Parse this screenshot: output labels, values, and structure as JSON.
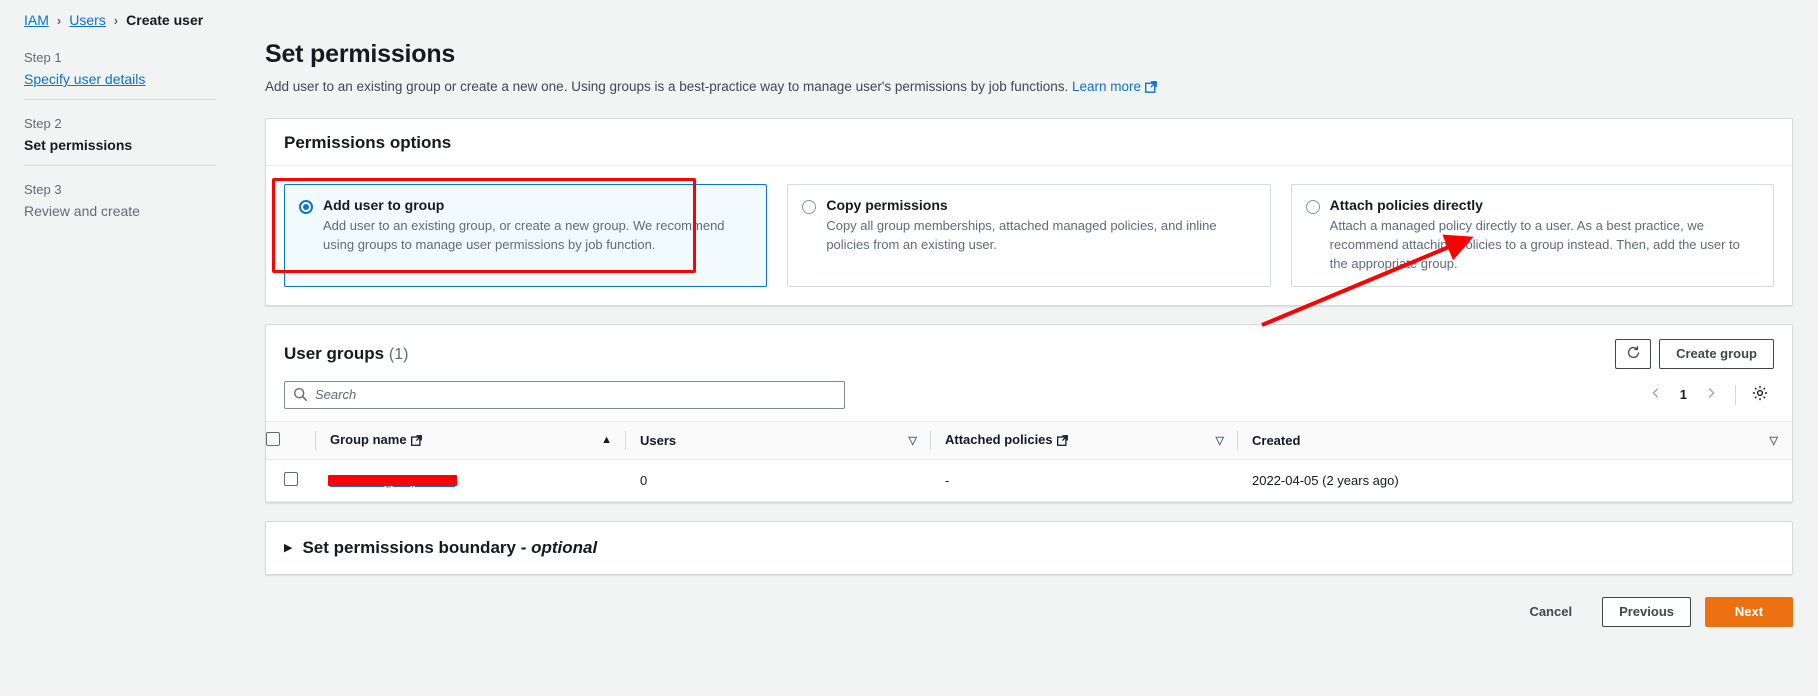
{
  "breadcrumb": {
    "items": [
      {
        "label": "IAM",
        "link": true
      },
      {
        "label": "Users",
        "link": true
      },
      {
        "label": "Create user",
        "link": false
      }
    ],
    "separator": "›"
  },
  "wizard": {
    "steps": [
      {
        "number": "Step 1",
        "title": "Specify user details",
        "state": "link"
      },
      {
        "number": "Step 2",
        "title": "Set permissions",
        "state": "active"
      },
      {
        "number": "Step 3",
        "title": "Review and create",
        "state": "idle"
      }
    ]
  },
  "page": {
    "title": "Set permissions",
    "description": "Add user to an existing group or create a new one. Using groups is a best-practice way to manage user's permissions by job functions.",
    "learn_more": "Learn more"
  },
  "permissions_options": {
    "heading": "Permissions options",
    "options": [
      {
        "label": "Add user to group",
        "description": "Add user to an existing group, or create a new group. We recommend using groups to manage user permissions by job function.",
        "selected": true
      },
      {
        "label": "Copy permissions",
        "description": "Copy all group memberships, attached managed policies, and inline policies from an existing user.",
        "selected": false
      },
      {
        "label": "Attach policies directly",
        "description": "Attach a managed policy directly to a user. As a best practice, we recommend attaching policies to a group instead. Then, add the user to the appropriate group.",
        "selected": false
      }
    ]
  },
  "user_groups": {
    "heading": "User groups",
    "count": "(1)",
    "refresh_label": "refresh-icon",
    "create_group_label": "Create group",
    "search": {
      "placeholder": "Search",
      "value": ""
    },
    "pagination": {
      "previous": "‹",
      "page": "1",
      "next": "›",
      "settings": "gear-icon"
    },
    "columns": [
      {
        "label": "Group name",
        "external": true,
        "sort": "asc"
      },
      {
        "label": "Users",
        "external": false,
        "sort": "idle"
      },
      {
        "label": "Attached policies",
        "external": true,
        "sort": "idle"
      },
      {
        "label": "Created",
        "external": false,
        "sort": "idle"
      }
    ],
    "rows": [
      {
        "group_name": "redacted-group-name",
        "users": "0",
        "attached_policies": "-",
        "created": "2022-04-05 (2 years ago)"
      }
    ]
  },
  "permissions_boundary": {
    "title": "Set permissions boundary - ",
    "optional": "optional"
  },
  "footer": {
    "cancel": "Cancel",
    "previous": "Previous",
    "next": "Next"
  },
  "colors": {
    "accent": "#0972d3",
    "primary_button": "#ec7211",
    "annotation": "#ff0000",
    "selected_tile_bg": "#f1faff"
  }
}
